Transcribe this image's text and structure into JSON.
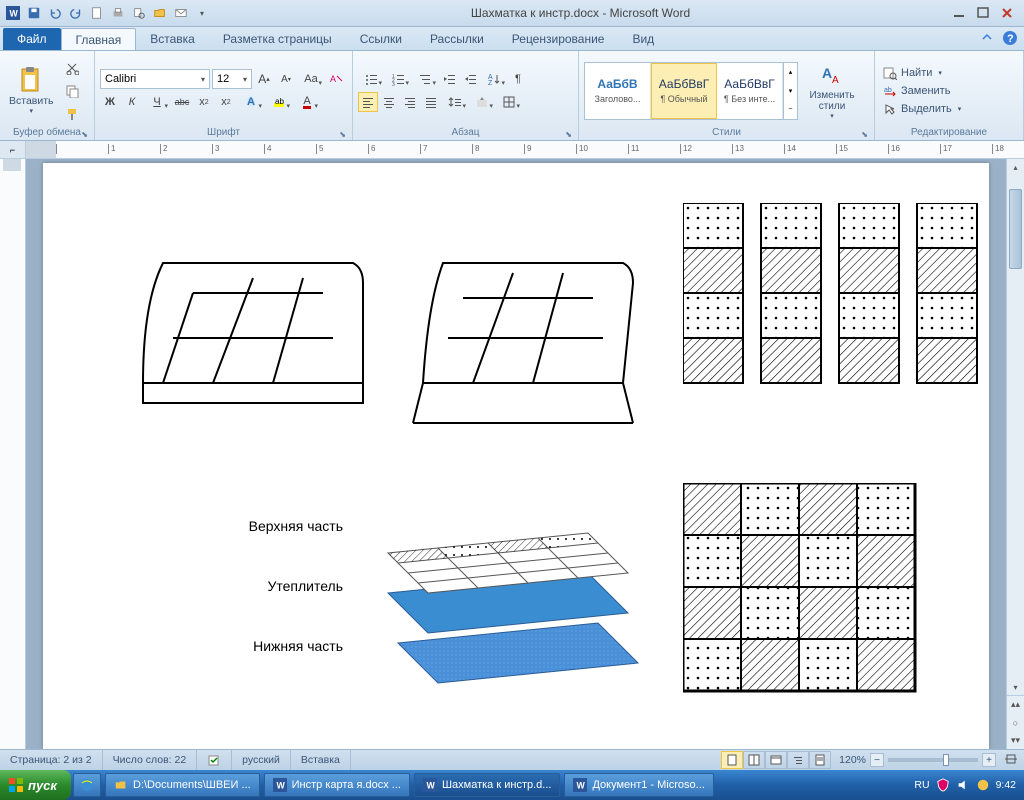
{
  "window": {
    "title": "Шахматка к инстр.docx - Microsoft Word"
  },
  "tabs": {
    "file": "Файл",
    "home": "Главная",
    "insert": "Вставка",
    "layout": "Разметка страницы",
    "references": "Ссылки",
    "mailings": "Рассылки",
    "review": "Рецензирование",
    "view": "Вид"
  },
  "ribbon": {
    "clipboard": {
      "label": "Буфер обмена",
      "paste": "Вставить"
    },
    "font": {
      "label": "Шрифт",
      "name": "Calibri",
      "size": "12",
      "bold": "Ж",
      "italic": "К",
      "underline": "Ч",
      "strike": "abc"
    },
    "paragraph": {
      "label": "Абзац"
    },
    "styles": {
      "label": "Стили",
      "preview": "АаБбВ",
      "preview2": "АаБбВвГ",
      "items": [
        "Заголово...",
        "¶ Обычный",
        "¶ Без инте..."
      ],
      "change": "Изменить стили"
    },
    "editing": {
      "label": "Редактирование",
      "find": "Найти",
      "replace": "Заменить",
      "select": "Выделить"
    }
  },
  "document": {
    "label_top": "Верхняя часть",
    "label_mid": "Утеплитель",
    "label_bot": "Нижняя часть"
  },
  "status": {
    "page": "Страница: 2 из 2",
    "words": "Число слов: 22",
    "lang": "русский",
    "mode": "Вставка",
    "zoom": "120%"
  },
  "taskbar": {
    "start": "пуск",
    "items": [
      "D:\\Documents\\ШВЕИ ...",
      "Инстр карта я.docx ...",
      "Шахматка к инстр.d...",
      "Документ1 - Microso..."
    ],
    "lang": "RU",
    "time": "9:42"
  }
}
